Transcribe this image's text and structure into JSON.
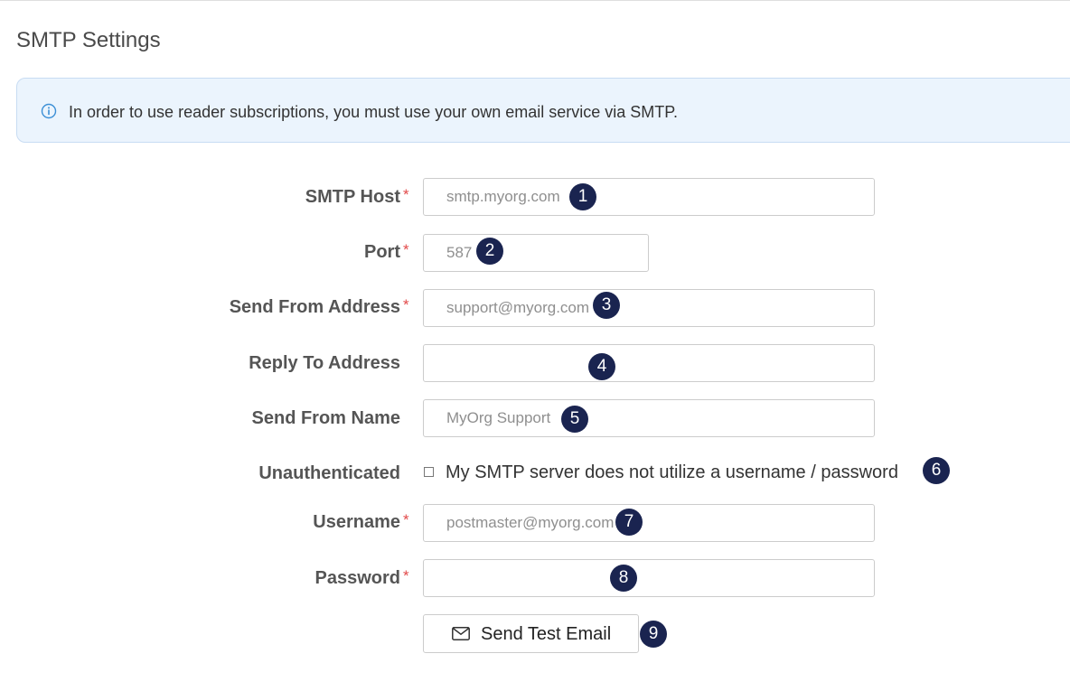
{
  "page": {
    "title": "SMTP Settings"
  },
  "alert": {
    "icon": "info-circle-icon",
    "text": "In order to use reader subscriptions, you must use your own email service via SMTP."
  },
  "form": {
    "smtp_host": {
      "label": "SMTP Host",
      "required_mark": "*",
      "placeholder": "smtp.myorg.com"
    },
    "port": {
      "label": "Port",
      "required_mark": "*",
      "placeholder": "587"
    },
    "send_from_address": {
      "label": "Send From Address",
      "required_mark": "*",
      "placeholder": "support@myorg.com"
    },
    "reply_to_address": {
      "label": "Reply To Address",
      "placeholder": ""
    },
    "send_from_name": {
      "label": "Send From Name",
      "placeholder": "MyOrg Support"
    },
    "unauthenticated": {
      "label": "Unauthenticated",
      "checkbox_label": "My SMTP server does not utilize a username / password",
      "checked": false
    },
    "username": {
      "label": "Username",
      "required_mark": "*",
      "placeholder": "postmaster@myorg.com"
    },
    "password": {
      "label": "Password",
      "required_mark": "*",
      "placeholder": ""
    },
    "send_test_button": {
      "label": "Send Test Email",
      "icon": "envelope-icon"
    }
  },
  "callouts": [
    "1",
    "2",
    "3",
    "4",
    "5",
    "6",
    "7",
    "8",
    "9"
  ],
  "colors": {
    "alert_bg": "#ebf4fd",
    "alert_border": "#c8dcf3",
    "required": "#e24a4a",
    "badge": "#1a2450",
    "info_icon": "#3c8fd6"
  }
}
